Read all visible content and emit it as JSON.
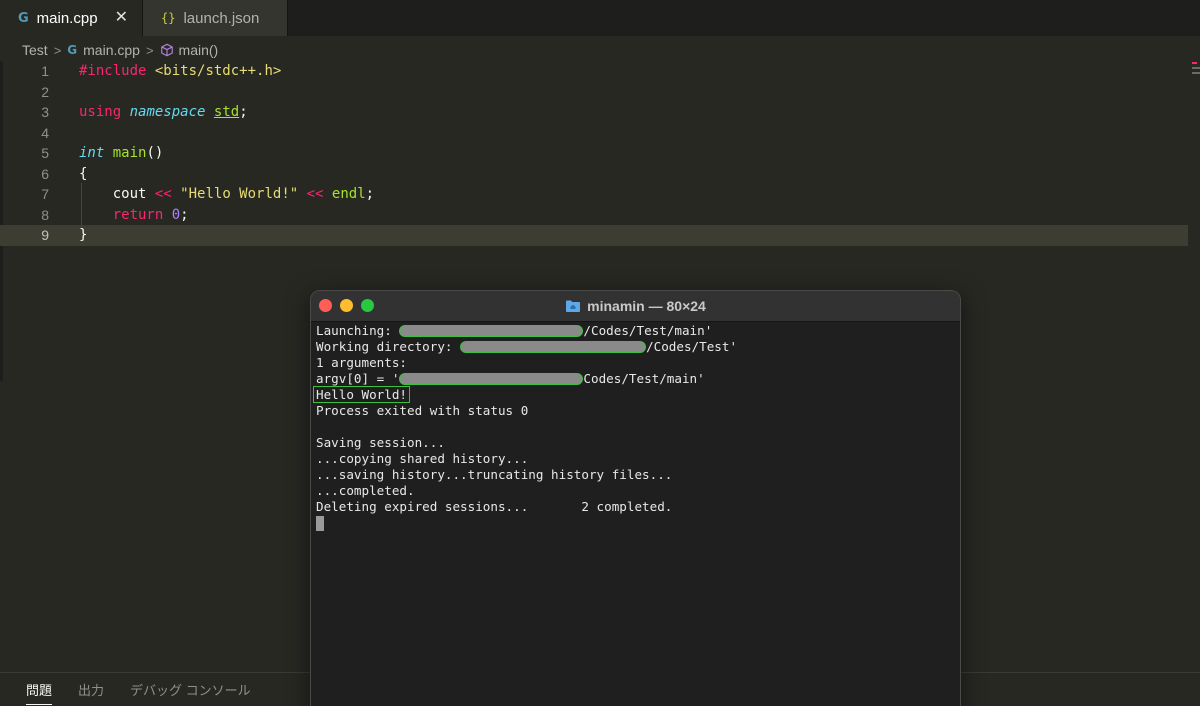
{
  "tabs": [
    {
      "label": "main.cpp",
      "icon": "cpp-file-icon",
      "close": "✕"
    },
    {
      "label": "launch.json",
      "icon": "json-file-icon",
      "icon_text": "{}"
    }
  ],
  "cpp_icon_glyph": "G",
  "breadcrumb": {
    "folder": "Test",
    "file": "main.cpp",
    "symbol": "main()",
    "separator": ">"
  },
  "editor": {
    "current_line": 9,
    "line_numbers": [
      "1",
      "2",
      "3",
      "4",
      "5",
      "6",
      "7",
      "8",
      "9"
    ],
    "lines": {
      "l1_directive": "#include",
      "l1_header": "<bits/stdc++.h>",
      "l3_using": "using",
      "l3_namespace": "namespace",
      "l3_std": "std",
      "l3_semi": ";",
      "l5_type": "int",
      "l5_name": "main",
      "l5_parens": "()",
      "l6_brace": "{",
      "l7_cout": "cout",
      "l7_op1": "<<",
      "l7_string": "\"Hello World!\"",
      "l7_op2": "<<",
      "l7_endl": "endl",
      "l7_semi": ";",
      "l8_return": "return",
      "l8_zero": "0",
      "l8_semi": ";",
      "l9_brace": "}"
    }
  },
  "panel": {
    "tabs": [
      "問題",
      "出力",
      "デバッグ コンソール"
    ],
    "active": "問題"
  },
  "terminal": {
    "title": "minamin — 80×24",
    "lines": {
      "launching_label": "Launching: ",
      "launching_suffix": "/Codes/Test/main'",
      "workdir_label": "Working directory: ",
      "workdir_suffix": "/Codes/Test'",
      "args": "1 arguments:",
      "argv_label": "argv[0] = '",
      "argv_suffix": "Codes/Test/main'",
      "hello": "Hello World!",
      "exit": "Process exited with status 0",
      "blank": "",
      "saving": "Saving session...",
      "copying": "...copying shared history...",
      "history": "...saving history...truncating history files...",
      "completed": "...completed.",
      "deleting": "Deleting expired sessions...       2 completed."
    }
  },
  "colors": {
    "editor_bg": "#272822",
    "keyword": "#f92672",
    "storage_type": "#66d9ef",
    "string": "#e6db74",
    "function": "#a6e22e",
    "number": "#ae81ff",
    "terminal_bg": "#1f1f1f",
    "highlight_box": "#3fbf3f"
  }
}
